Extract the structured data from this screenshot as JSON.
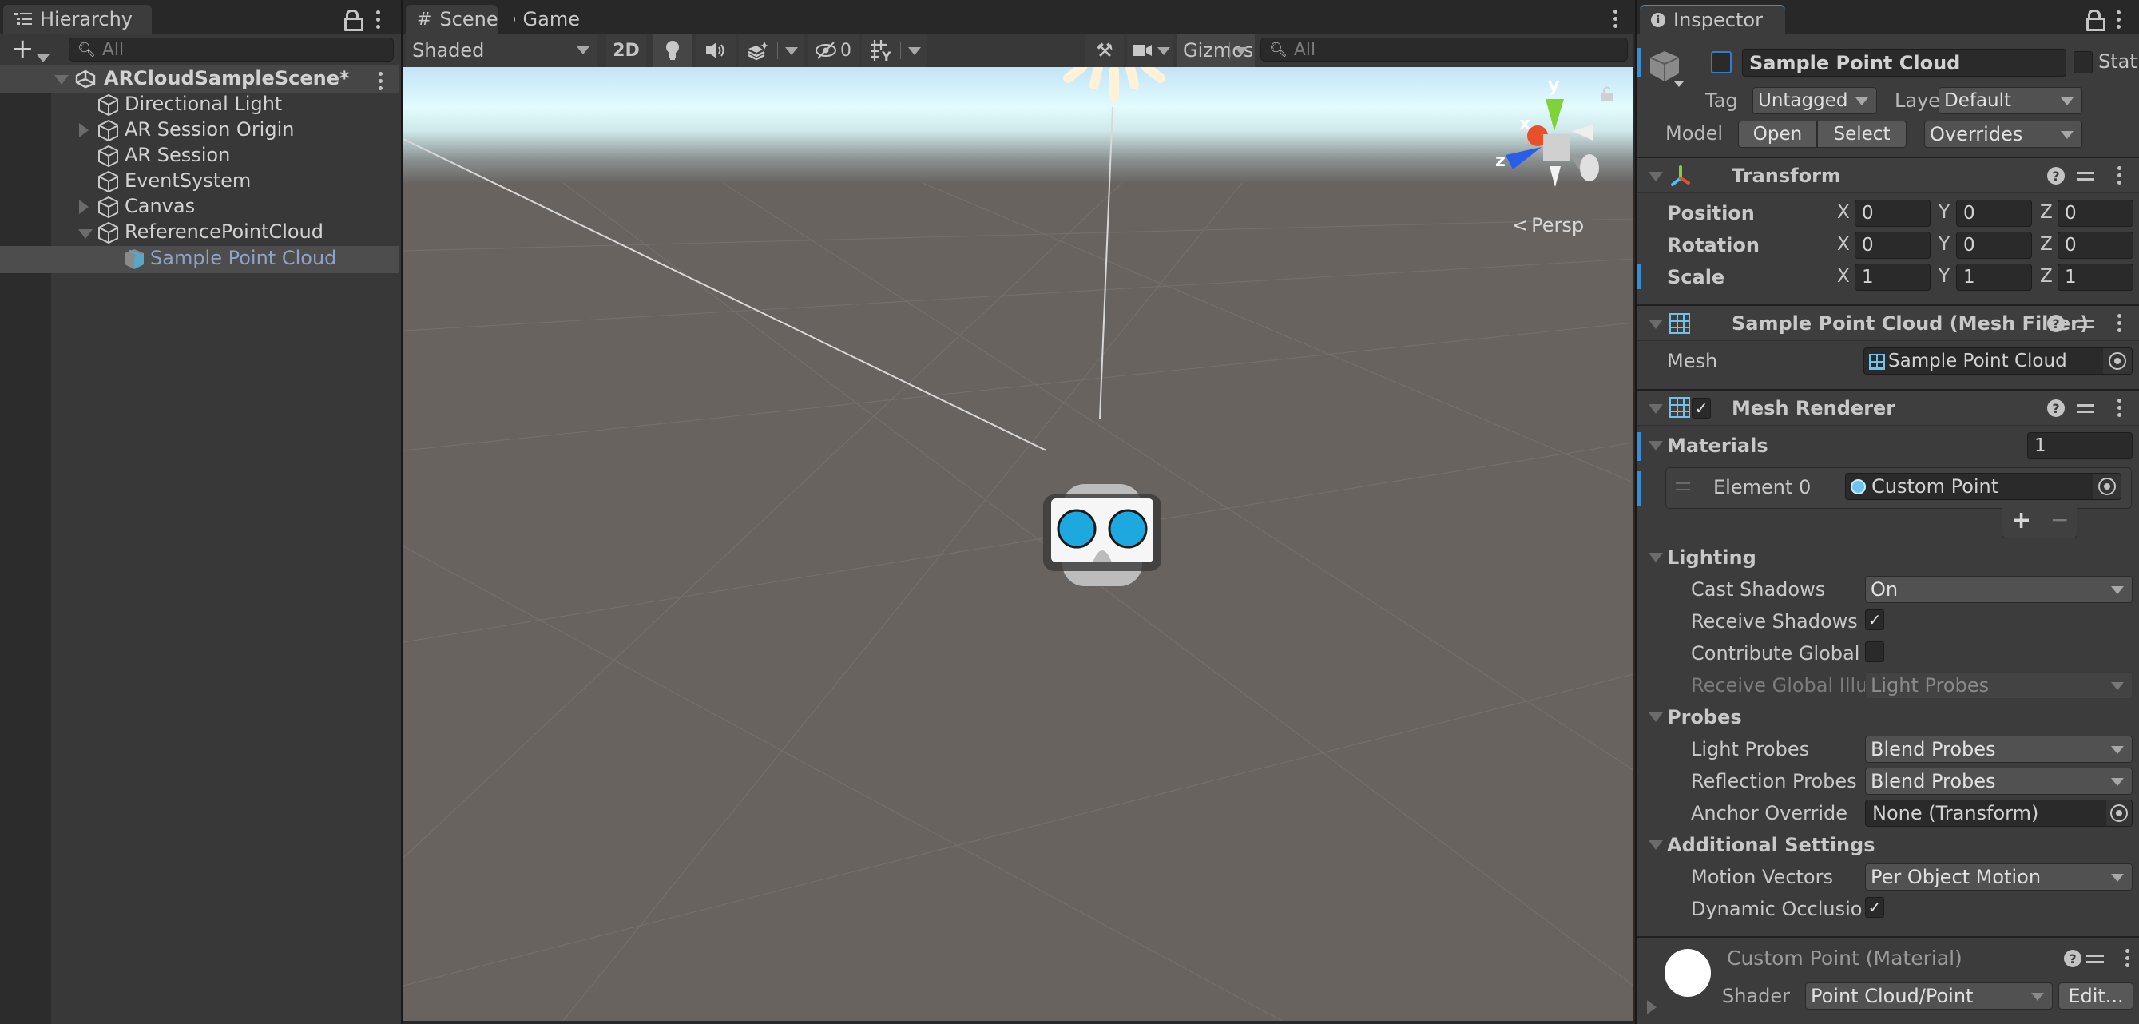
{
  "hierarchy": {
    "tab_label": "Hierarchy",
    "search_placeholder": "All",
    "scene_name": "ARCloudSampleScene*",
    "items": [
      {
        "label": "Directional Light",
        "expandable": false
      },
      {
        "label": "AR Session Origin",
        "expandable": true,
        "expanded": false
      },
      {
        "label": "AR Session",
        "expandable": false
      },
      {
        "label": "EventSystem",
        "expandable": false
      },
      {
        "label": "Canvas",
        "expandable": true,
        "expanded": false
      },
      {
        "label": "ReferencePointCloud",
        "expandable": true,
        "expanded": true
      },
      {
        "label": "Sample Point Cloud",
        "selected": true,
        "prefab": true
      }
    ]
  },
  "scene_view": {
    "tabs": [
      {
        "label": "Scene",
        "icon": "grid-hash-icon",
        "active": true
      },
      {
        "label": "Game",
        "icon": "gamepad-icon",
        "active": false
      }
    ],
    "shading_mode": "Shaded",
    "mode_2d_label": "2D",
    "hidden_count": "0",
    "gizmos_label": "Gizmos",
    "search_placeholder": "All",
    "projection_label": "Persp",
    "axis_labels": {
      "x": "x",
      "y": "y",
      "z": "z"
    }
  },
  "inspector": {
    "tab_label": "Inspector",
    "object_name": "Sample Point Cloud",
    "active_checked": false,
    "static_label": "Static",
    "static_checked": false,
    "tag_label": "Tag",
    "tag_value": "Untagged",
    "layer_label": "Layer",
    "layer_value": "Default",
    "model_label": "Model",
    "open_label": "Open",
    "select_label": "Select",
    "overrides_label": "Overrides",
    "transform": {
      "title": "Transform",
      "rows": [
        {
          "label": "Position",
          "x": "0",
          "y": "0",
          "z": "0"
        },
        {
          "label": "Rotation",
          "x": "0",
          "y": "0",
          "z": "0"
        },
        {
          "label": "Scale",
          "x": "1",
          "y": "1",
          "z": "1"
        }
      ]
    },
    "mesh_filter": {
      "title": "Sample Point Cloud (Mesh Filter)",
      "mesh_label": "Mesh",
      "mesh_value": "Sample Point Cloud"
    },
    "mesh_renderer": {
      "title": "Mesh Renderer",
      "enabled": true,
      "materials_label": "Materials",
      "materials_count": "1",
      "element_label": "Element 0",
      "element_value": "Custom Point",
      "add_label": "+",
      "remove_label": "−",
      "lighting_label": "Lighting",
      "cast_shadows_label": "Cast Shadows",
      "cast_shadows_value": "On",
      "receive_shadows_label": "Receive Shadows",
      "receive_shadows_checked": true,
      "contribute_gi_label": "Contribute Global I",
      "contribute_gi_checked": false,
      "receive_gi_label": "Receive Global Illu",
      "receive_gi_value": "Light Probes",
      "probes_label": "Probes",
      "light_probes_label": "Light Probes",
      "light_probes_value": "Blend Probes",
      "reflection_probes_label": "Reflection Probes",
      "reflection_probes_value": "Blend Probes",
      "anchor_override_label": "Anchor Override",
      "anchor_override_value": "None (Transform)",
      "additional_label": "Additional Settings",
      "motion_vectors_label": "Motion Vectors",
      "motion_vectors_value": "Per Object Motion",
      "dynamic_occlusion_label": "Dynamic Occlusio",
      "dynamic_occlusion_checked": true
    },
    "material": {
      "title": "Custom Point (Material)",
      "shader_label": "Shader",
      "shader_value": "Point Cloud/Point",
      "edit_label": "Edit..."
    }
  },
  "colors": {
    "accent_blue": "#3a8fd4",
    "selection_text": "#8fa3c8",
    "mesh_icon": "#6ec4f0",
    "axis_x": "#e8502a",
    "axis_y": "#7ed23a",
    "axis_z": "#2a5ee8"
  },
  "icons": {
    "checkmark": "✓",
    "help": "?"
  }
}
